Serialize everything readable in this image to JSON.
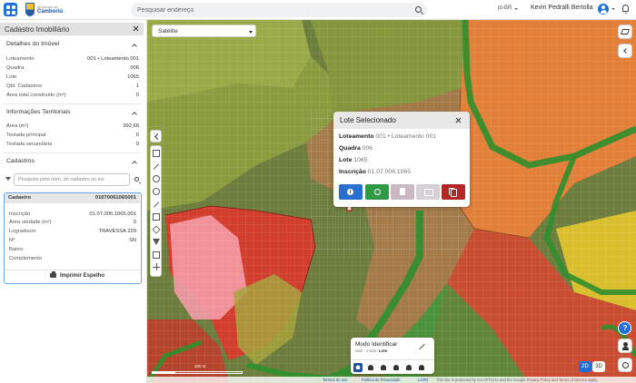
{
  "header": {
    "logo_top": "Município de",
    "logo_name": "Camboriú",
    "search_placeholder": "Pesquisar endereço",
    "language": "pt-BR",
    "user_name": "Kevin Pedralli Bertolla"
  },
  "panel": {
    "title": "Cadastro Imobiliário",
    "details": {
      "heading": "Detalhes do Imóvel",
      "rows": [
        {
          "label": "Loteamento",
          "value": "001 • Loteamento 001"
        },
        {
          "label": "Quadra",
          "value": "006"
        },
        {
          "label": "Lote",
          "value": "1065"
        },
        {
          "label": "Qtd. Cadastros",
          "value": "1"
        },
        {
          "label": "Área total construído (m²)",
          "value": "0"
        }
      ]
    },
    "territorial": {
      "heading": "Informações Territoriais",
      "rows": [
        {
          "label": "Área (m²)",
          "value": "392,66"
        },
        {
          "label": "Testada principal",
          "value": "0"
        },
        {
          "label": "Testada secundária",
          "value": "0"
        }
      ]
    },
    "cadastros": {
      "heading": "Cadastros",
      "search_placeholder": "Pesquise pelo núm. do cadastro ou ins",
      "card": {
        "title": "Cadastro",
        "id": "01070061065001",
        "rows": [
          {
            "label": "Inscrição",
            "value": "01.07.006.1065.001"
          },
          {
            "label": "Área unidade (m²)",
            "value": "0"
          },
          {
            "label": "Logradouro",
            "value": "TRAVESSA 229"
          },
          {
            "label": "Nº",
            "value": "SN"
          },
          {
            "label": "Bairro",
            "value": ""
          },
          {
            "label": "Complemento",
            "value": ""
          }
        ],
        "print_label": "Imprimir Espelho"
      }
    }
  },
  "map": {
    "layer_select": "Satélite",
    "scale_label": "200 m",
    "mode_2d": "2D",
    "mode_3d": "3D"
  },
  "popup": {
    "title": "Lote Selecionado",
    "rows": [
      {
        "label": "Loteamento",
        "value": "001 • Loteamento 001"
      },
      {
        "label": "Quadra",
        "value": "006"
      },
      {
        "label": "Lote",
        "value": "1065"
      },
      {
        "label": "Inscrição",
        "value": "01.07.006.1065"
      }
    ]
  },
  "mode_panel": {
    "title": "Modo Identificar",
    "sub_prefix": "Sub - modo:",
    "sub_value": "Lote"
  },
  "footer": {
    "links": [
      "Termos de uso",
      "Política de Privacidade",
      "LGPD"
    ],
    "recaptcha": "This site is protected by reCAPTCHA and the Google Privacy Policy and Terms of Service apply."
  },
  "colors": {
    "accent": "#1e6fd9",
    "zone_red": "#e03a2f",
    "zone_orange": "#f07d2e",
    "zone_green": "#2e9a3f",
    "zone_yellow": "#e6c72c",
    "zone_pink": "#f08a9a"
  }
}
